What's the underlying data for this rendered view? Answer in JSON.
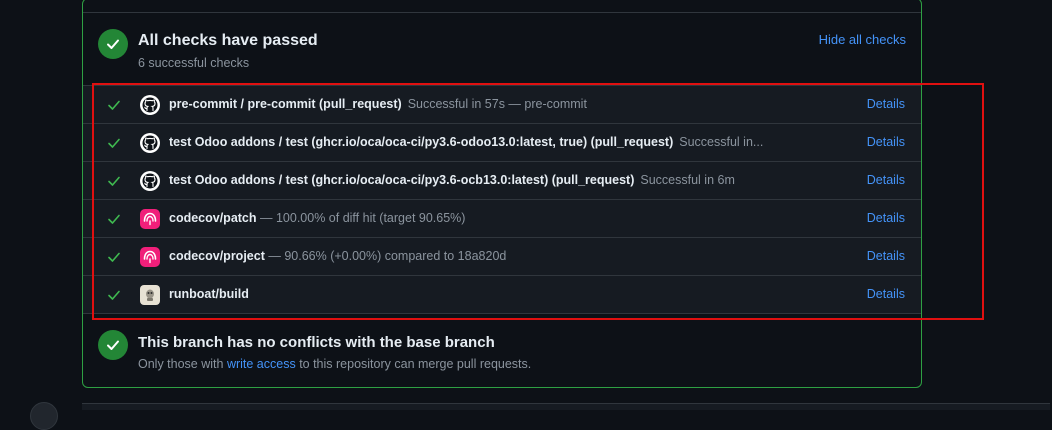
{
  "summary": {
    "title": "All checks have passed",
    "subtitle": "6 successful checks",
    "hide_link": "Hide all checks"
  },
  "checks": [
    {
      "name": "pre-commit / pre-commit (pull_request)",
      "description": "Successful in 57s — pre-commit",
      "logo": "github-icon",
      "details": "Details"
    },
    {
      "name": "test Odoo addons / test (ghcr.io/oca/oca-ci/py3.6-odoo13.0:latest, true) (pull_request)",
      "description": "Successful in...",
      "logo": "github-icon",
      "details": "Details"
    },
    {
      "name": "test Odoo addons / test (ghcr.io/oca/oca-ci/py3.6-ocb13.0:latest) (pull_request)",
      "description": "Successful in 6m",
      "logo": "github-icon",
      "details": "Details"
    },
    {
      "name": "codecov/patch",
      "description": " — 100.00% of diff hit (target 90.65%)",
      "logo": "codecov-icon",
      "details": "Details"
    },
    {
      "name": "codecov/project",
      "description": " — 90.66% (+0.00%) compared to 18a820d",
      "logo": "codecov-icon",
      "details": "Details"
    },
    {
      "name": "runboat/build",
      "description": "",
      "logo": "runboat-icon",
      "details": "Details"
    }
  ],
  "merge": {
    "title": "This branch has no conflicts with the base branch",
    "sub_prefix": "Only those with ",
    "sub_link": "write access",
    "sub_suffix": " to this repository can merge pull requests."
  },
  "colors": {
    "success": "#238636",
    "link": "#4493f8",
    "highlight": "#e01010",
    "codecov": "#f01f7a"
  }
}
